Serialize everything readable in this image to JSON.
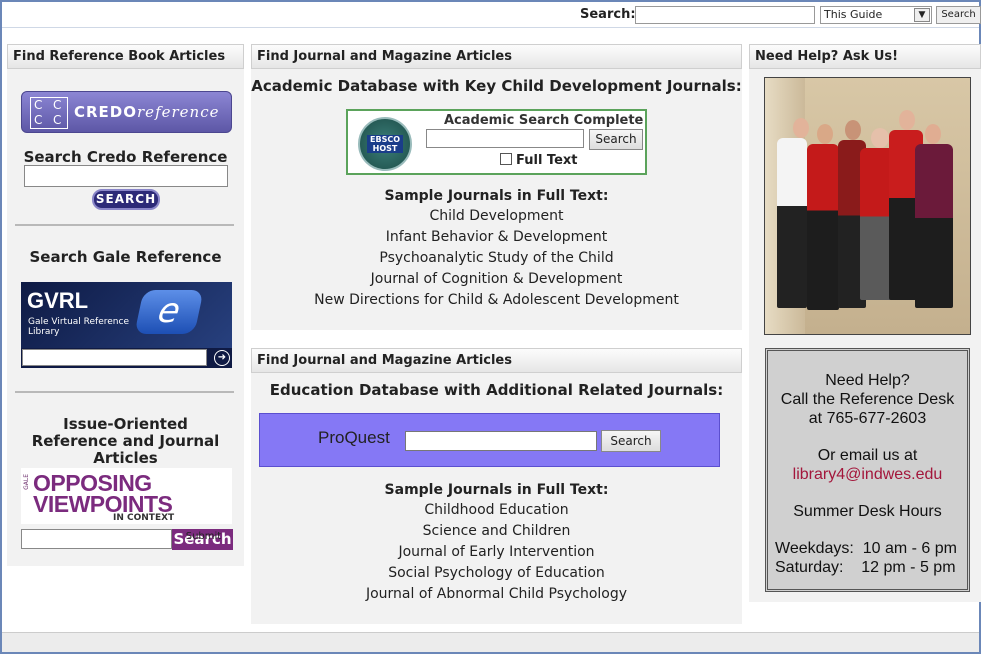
{
  "topbar": {
    "search_label": "Search:",
    "search_value": "",
    "scope_selected": "This Guide",
    "search_button": "Search"
  },
  "left": {
    "header": "Find Reference Book Articles",
    "credo": {
      "logo_letters": [
        "C",
        "C",
        "C",
        "C"
      ],
      "logo_word": "CREDO",
      "logo_word2": "reference",
      "title": "Search Credo Reference",
      "input_value": "",
      "button": "SEARCH"
    },
    "gale": {
      "title": "Search Gale Reference",
      "logo_title": "GVRL",
      "logo_sub": "Gale Virtual Reference Library",
      "input_value": ""
    },
    "opposing": {
      "title": "Issue-Oriented Reference and Journal Articles",
      "logo_gale": "GALE",
      "logo_line1": "OPPOSING",
      "logo_line2": "VIEWPOINTS",
      "logo_line3": "IN CONTEXT",
      "input_value": "",
      "button_overlay": "Submit Query",
      "button": "Search"
    }
  },
  "mid1": {
    "header": "Find Journal and Magazine Articles",
    "subtitle": "Academic Database with Key Child Development Journals:",
    "ebsco": {
      "logo": "EBSCO HOST",
      "title": "Academic Search Complete",
      "input_value": "",
      "button": "Search",
      "checkbox_label": "Full Text",
      "checked": false
    },
    "journals_heading": "Sample Journals in Full Text:",
    "journals": [
      "Child Development",
      "Infant Behavior & Development",
      "Psychoanalytic Study of the Child",
      "Journal of Cognition & Development",
      "New Directions for Child & Adolescent Development"
    ]
  },
  "mid2": {
    "header": "Find Journal and Magazine Articles",
    "subtitle": "Education Database with Additional Related Journals:",
    "proquest": {
      "logo": "ProQuest",
      "input_value": "",
      "button": "Search"
    },
    "journals_heading": "Sample Journals in Full Text:",
    "journals": [
      "Childhood Education",
      "Science and Children",
      "Journal of Early Intervention",
      "Social Psychology of Education",
      "Journal of Abnormal Child Psychology"
    ]
  },
  "right": {
    "header": "Need Help? Ask Us!",
    "help": {
      "line1": "Need Help?",
      "line2": "Call the Reference Desk",
      "line3": "at 765-677-2603",
      "line4": "Or email us at",
      "email": "library4@indwes.edu",
      "hours_title": "Summer Desk Hours",
      "weekdays": "Weekdays:  10 am - 6 pm",
      "saturday": "Saturday:    12 pm - 5 pm"
    }
  },
  "colors": {
    "credo": "#5d57a6",
    "proquest_bg": "#8578f5",
    "opposing": "#7b2b7e",
    "email": "#a3163b",
    "ebsco_border": "#5ba35b"
  }
}
